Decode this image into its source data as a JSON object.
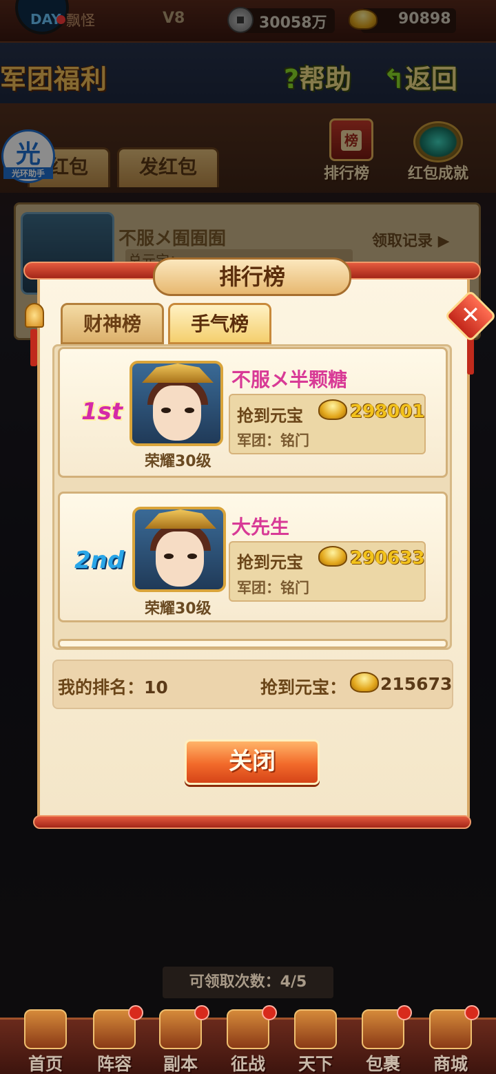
{
  "topbar": {
    "player_name": "飘怪",
    "vip": "V8",
    "copper": "30058万",
    "gold": "90898"
  },
  "header": {
    "title": "军团福利",
    "help_label": "帮助",
    "back_label": "返回"
  },
  "page": {
    "tabs": [
      "红包",
      "发红包"
    ],
    "icons": [
      {
        "label": "排行榜",
        "icon": "scroll-rank-icon"
      },
      {
        "label": "红包成就",
        "icon": "gem-achievement-icon"
      }
    ],
    "helper_badge": {
      "glyph": "光",
      "text": "光环助手"
    },
    "behind_card": {
      "name": "不服メ囿囿囿",
      "sub_label": "总元宝：",
      "record_link": "领取记录"
    }
  },
  "modal": {
    "title": "排行榜",
    "tabs": [
      {
        "label": "财神榜",
        "active": false
      },
      {
        "label": "手气榜",
        "active": true
      }
    ],
    "entries": [
      {
        "rank": "1st",
        "name": "不服メ半颗糖",
        "level": "荣耀30级",
        "grab_label": "抢到元宝",
        "amount": "298001",
        "guild_label": "军团：",
        "guild": "铭门"
      },
      {
        "rank": "2nd",
        "name": "大先生",
        "level": "荣耀30级",
        "grab_label": "抢到元宝",
        "amount": "290633",
        "guild_label": "军团：",
        "guild": "铭门"
      }
    ],
    "my_rank_label": "我的排名：",
    "my_rank": "10",
    "my_grab_label": "抢到元宝：",
    "my_amount": "215673",
    "close_label": "关闭"
  },
  "footer": {
    "claim_text": "可领取次数：4/5",
    "nav": [
      "首页",
      "阵容",
      "副本",
      "征战",
      "天下",
      "包裹",
      "商城"
    ]
  },
  "colors": {
    "rank1": "#d42aa8",
    "rank2": "#2aa6e8",
    "gold_text": "#f2c21c",
    "name_pink": "#d83a96",
    "close_button": "#f26a2a"
  }
}
